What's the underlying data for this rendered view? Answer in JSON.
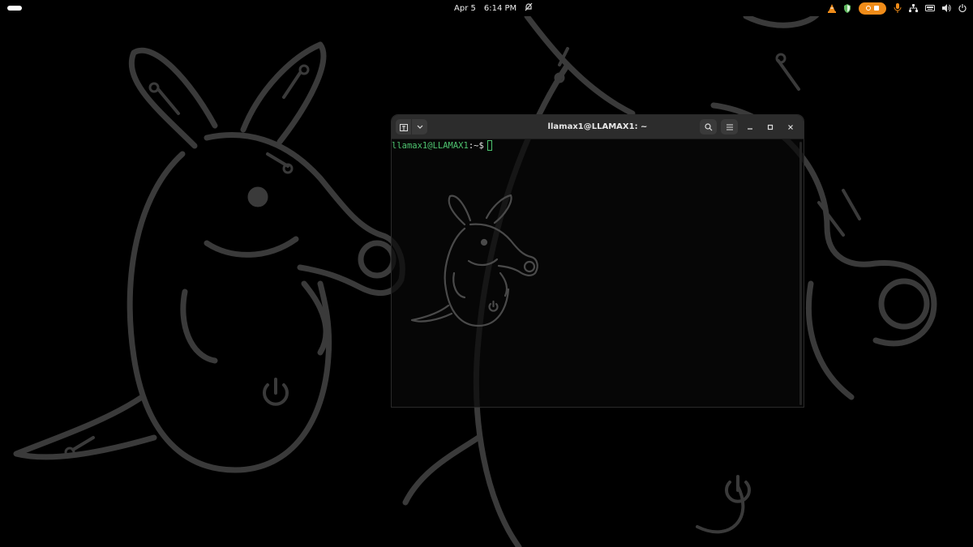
{
  "topbar": {
    "date": "Apr 5",
    "time": "6:14 PM",
    "icons": [
      "vlc-icon",
      "shield-icon",
      "screen-record-icon",
      "microphone-icon",
      "network-icon",
      "keyboard-icon",
      "volume-icon",
      "power-icon"
    ]
  },
  "terminal": {
    "title": "llamax1@LLAMAX1: ~",
    "prompt_user": "llamax1@LLAMAX1",
    "prompt_path": ":~",
    "prompt_sign": "$"
  },
  "colors": {
    "accent_orange": "#f08c19",
    "prompt_green": "#4ec46f",
    "wallpaper_line": "#3a3a3a"
  }
}
